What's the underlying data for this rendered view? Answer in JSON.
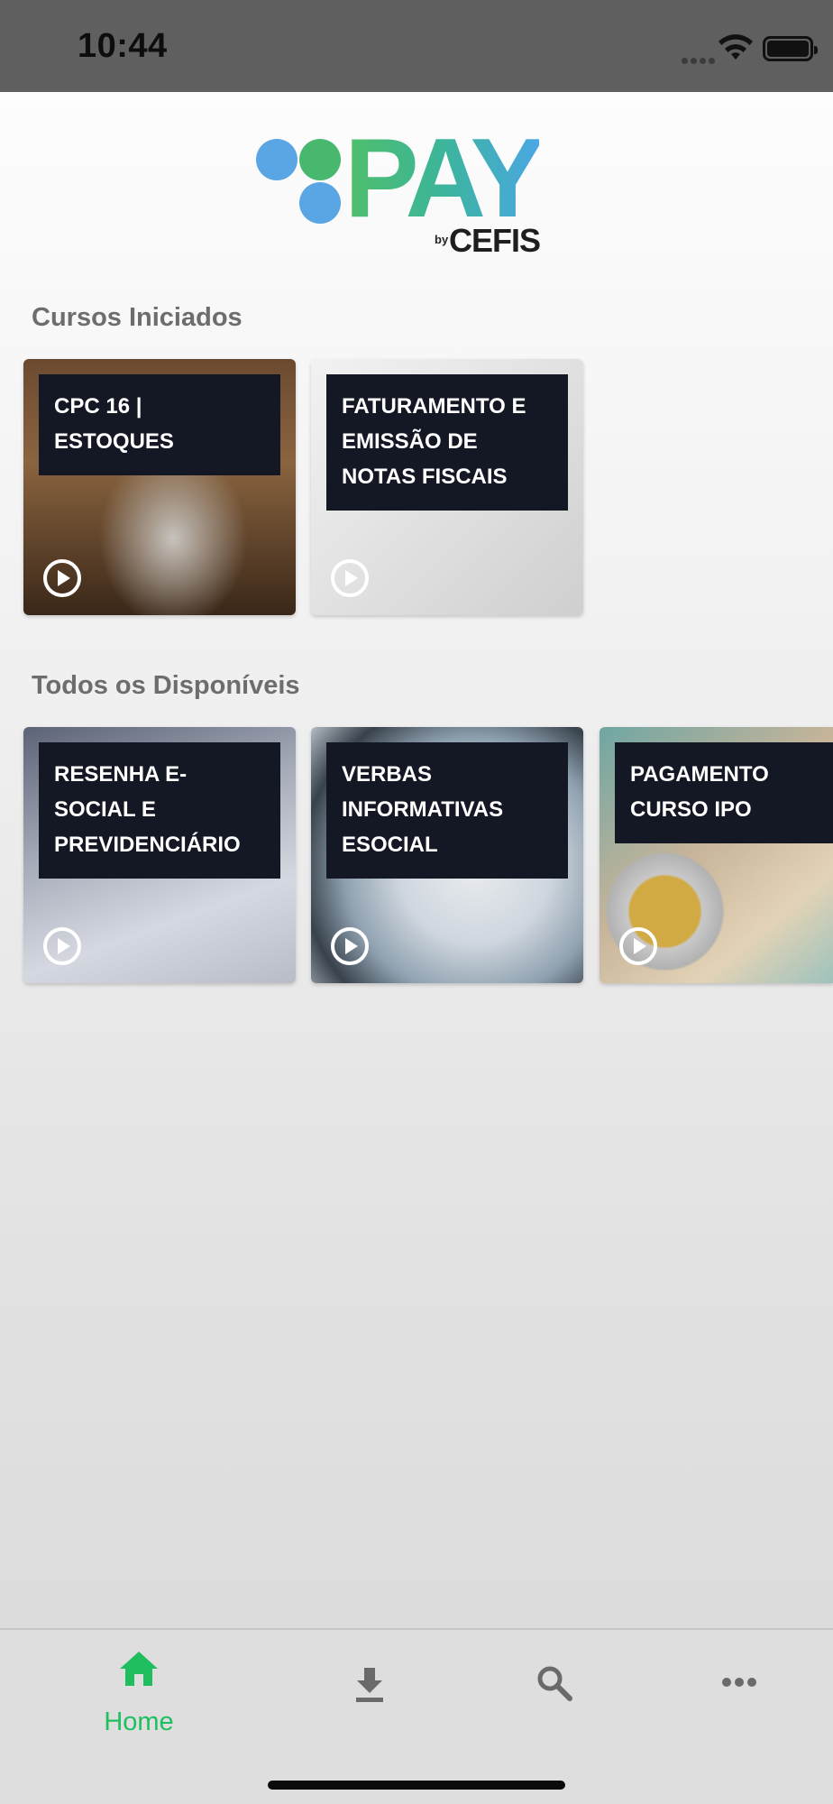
{
  "status_bar": {
    "time": "10:44",
    "icons": [
      "signal-icon",
      "wifi-icon",
      "battery-icon"
    ]
  },
  "logo": {
    "word": "PAY",
    "by": "by",
    "brand": "CEFIS",
    "colors": {
      "green": "#4fbf6a",
      "blue": "#4aa7e4",
      "dark": "#1e1e1e"
    }
  },
  "sections": {
    "started": {
      "title": "Cursos Iniciados",
      "courses": [
        {
          "title": "CPC 16 | ESTOQUES",
          "icon": "play-icon"
        },
        {
          "title": "FATURAMENTO E EMISSÃO DE NOTAS FISCAIS",
          "icon": "play-icon"
        }
      ]
    },
    "available": {
      "title": "Todos os Disponíveis",
      "courses": [
        {
          "title": "RESENHA E-SOCIAL E PREVIDENCIÁRIO",
          "icon": "play-icon"
        },
        {
          "title": "VERBAS INFORMATIVAS ESOCIAL",
          "icon": "play-icon"
        },
        {
          "title": "PAGAMENTO CURSO IPO",
          "icon": "play-icon"
        }
      ]
    }
  },
  "tab_bar": {
    "active_color": "#1fbf5f",
    "inactive_color": "#6a6a6a",
    "tabs": [
      {
        "label": "Home",
        "icon": "home-icon",
        "active": true
      },
      {
        "label": "",
        "icon": "download-icon",
        "active": false
      },
      {
        "label": "",
        "icon": "search-icon",
        "active": false
      },
      {
        "label": "",
        "icon": "more-icon",
        "active": false
      }
    ]
  }
}
